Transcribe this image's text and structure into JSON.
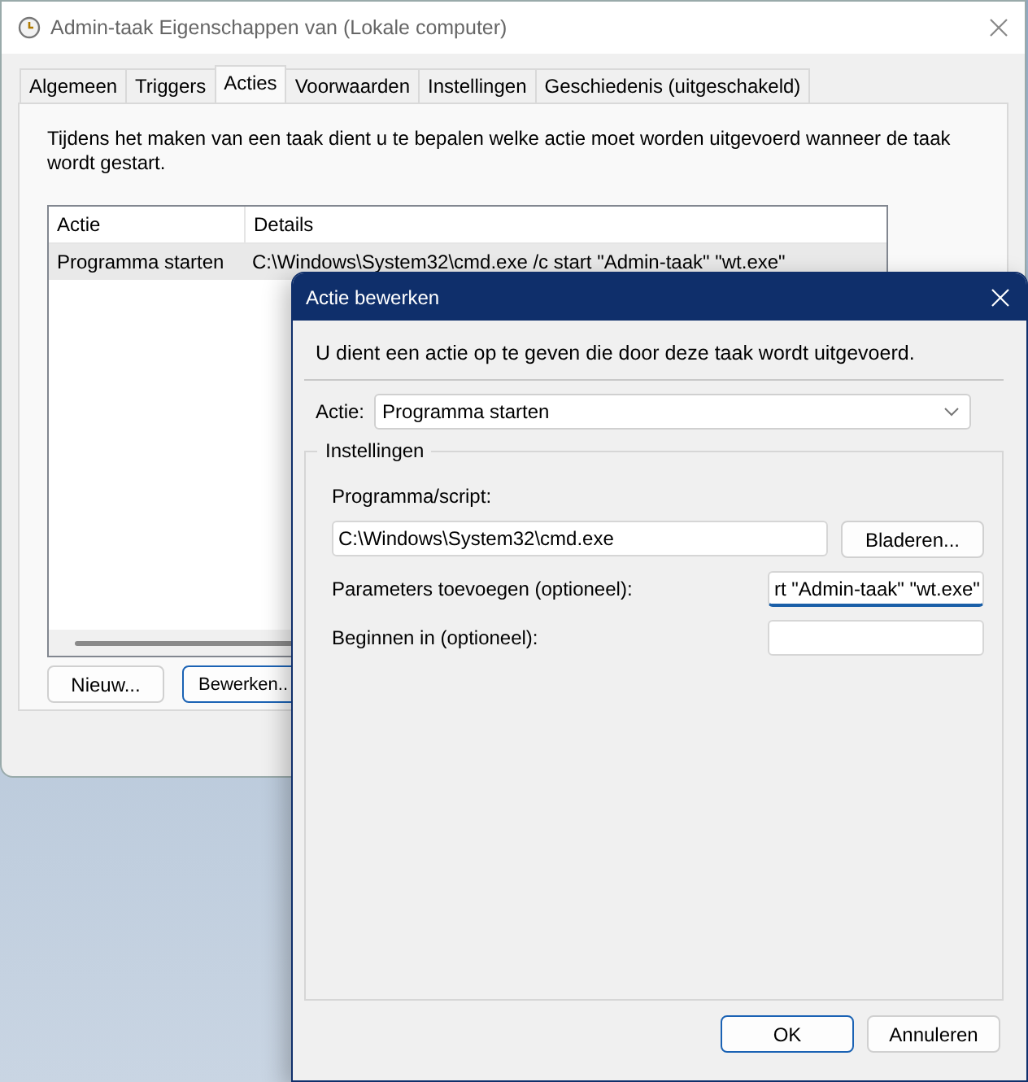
{
  "main_window": {
    "title": "Admin-taak Eigenschappen van (Lokale computer)",
    "tabs": [
      {
        "label": "Algemeen",
        "selected": false
      },
      {
        "label": "Triggers",
        "selected": false
      },
      {
        "label": "Acties",
        "selected": true
      },
      {
        "label": "Voorwaarden",
        "selected": false
      },
      {
        "label": "Instellingen",
        "selected": false
      },
      {
        "label": "Geschiedenis (uitgeschakeld)",
        "selected": false
      }
    ],
    "description": "Tijdens het maken van een taak dient u te bepalen welke actie moet worden uitgevoerd wanneer de taak wordt gestart.",
    "table": {
      "columns": [
        "Actie",
        "Details"
      ],
      "rows": [
        {
          "cells": [
            "Programma starten",
            "C:\\Windows\\System32\\cmd.exe /c start \"Admin-taak\" \"wt.exe\""
          ],
          "selected": true
        }
      ]
    },
    "buttons": [
      {
        "label": "Nieuw...",
        "default": false
      },
      {
        "label": "Bewerken..",
        "default": true
      }
    ]
  },
  "dialog": {
    "title": "Actie bewerken",
    "description": "U dient een actie op te geven die door deze taak wordt uitgevoerd.",
    "action": {
      "label": "Actie:",
      "value": "Programma starten"
    },
    "group": {
      "title": "Instellingen",
      "fields": [
        {
          "kind": "stacked",
          "label": "Programma/script:",
          "value": "C:\\Windows\\System32\\cmd.exe",
          "button": "Bladeren...",
          "focused": false
        },
        {
          "kind": "inline",
          "label": "Parameters toevoegen (optioneel):",
          "value": "rt \"Admin-taak\" \"wt.exe\"",
          "focused": true
        },
        {
          "kind": "inline",
          "label": "Beginnen in (optioneel):",
          "focused": false
        }
      ]
    },
    "buttons": [
      {
        "label": "OK",
        "default": true
      },
      {
        "label": "Annuleren",
        "default": false
      }
    ]
  }
}
